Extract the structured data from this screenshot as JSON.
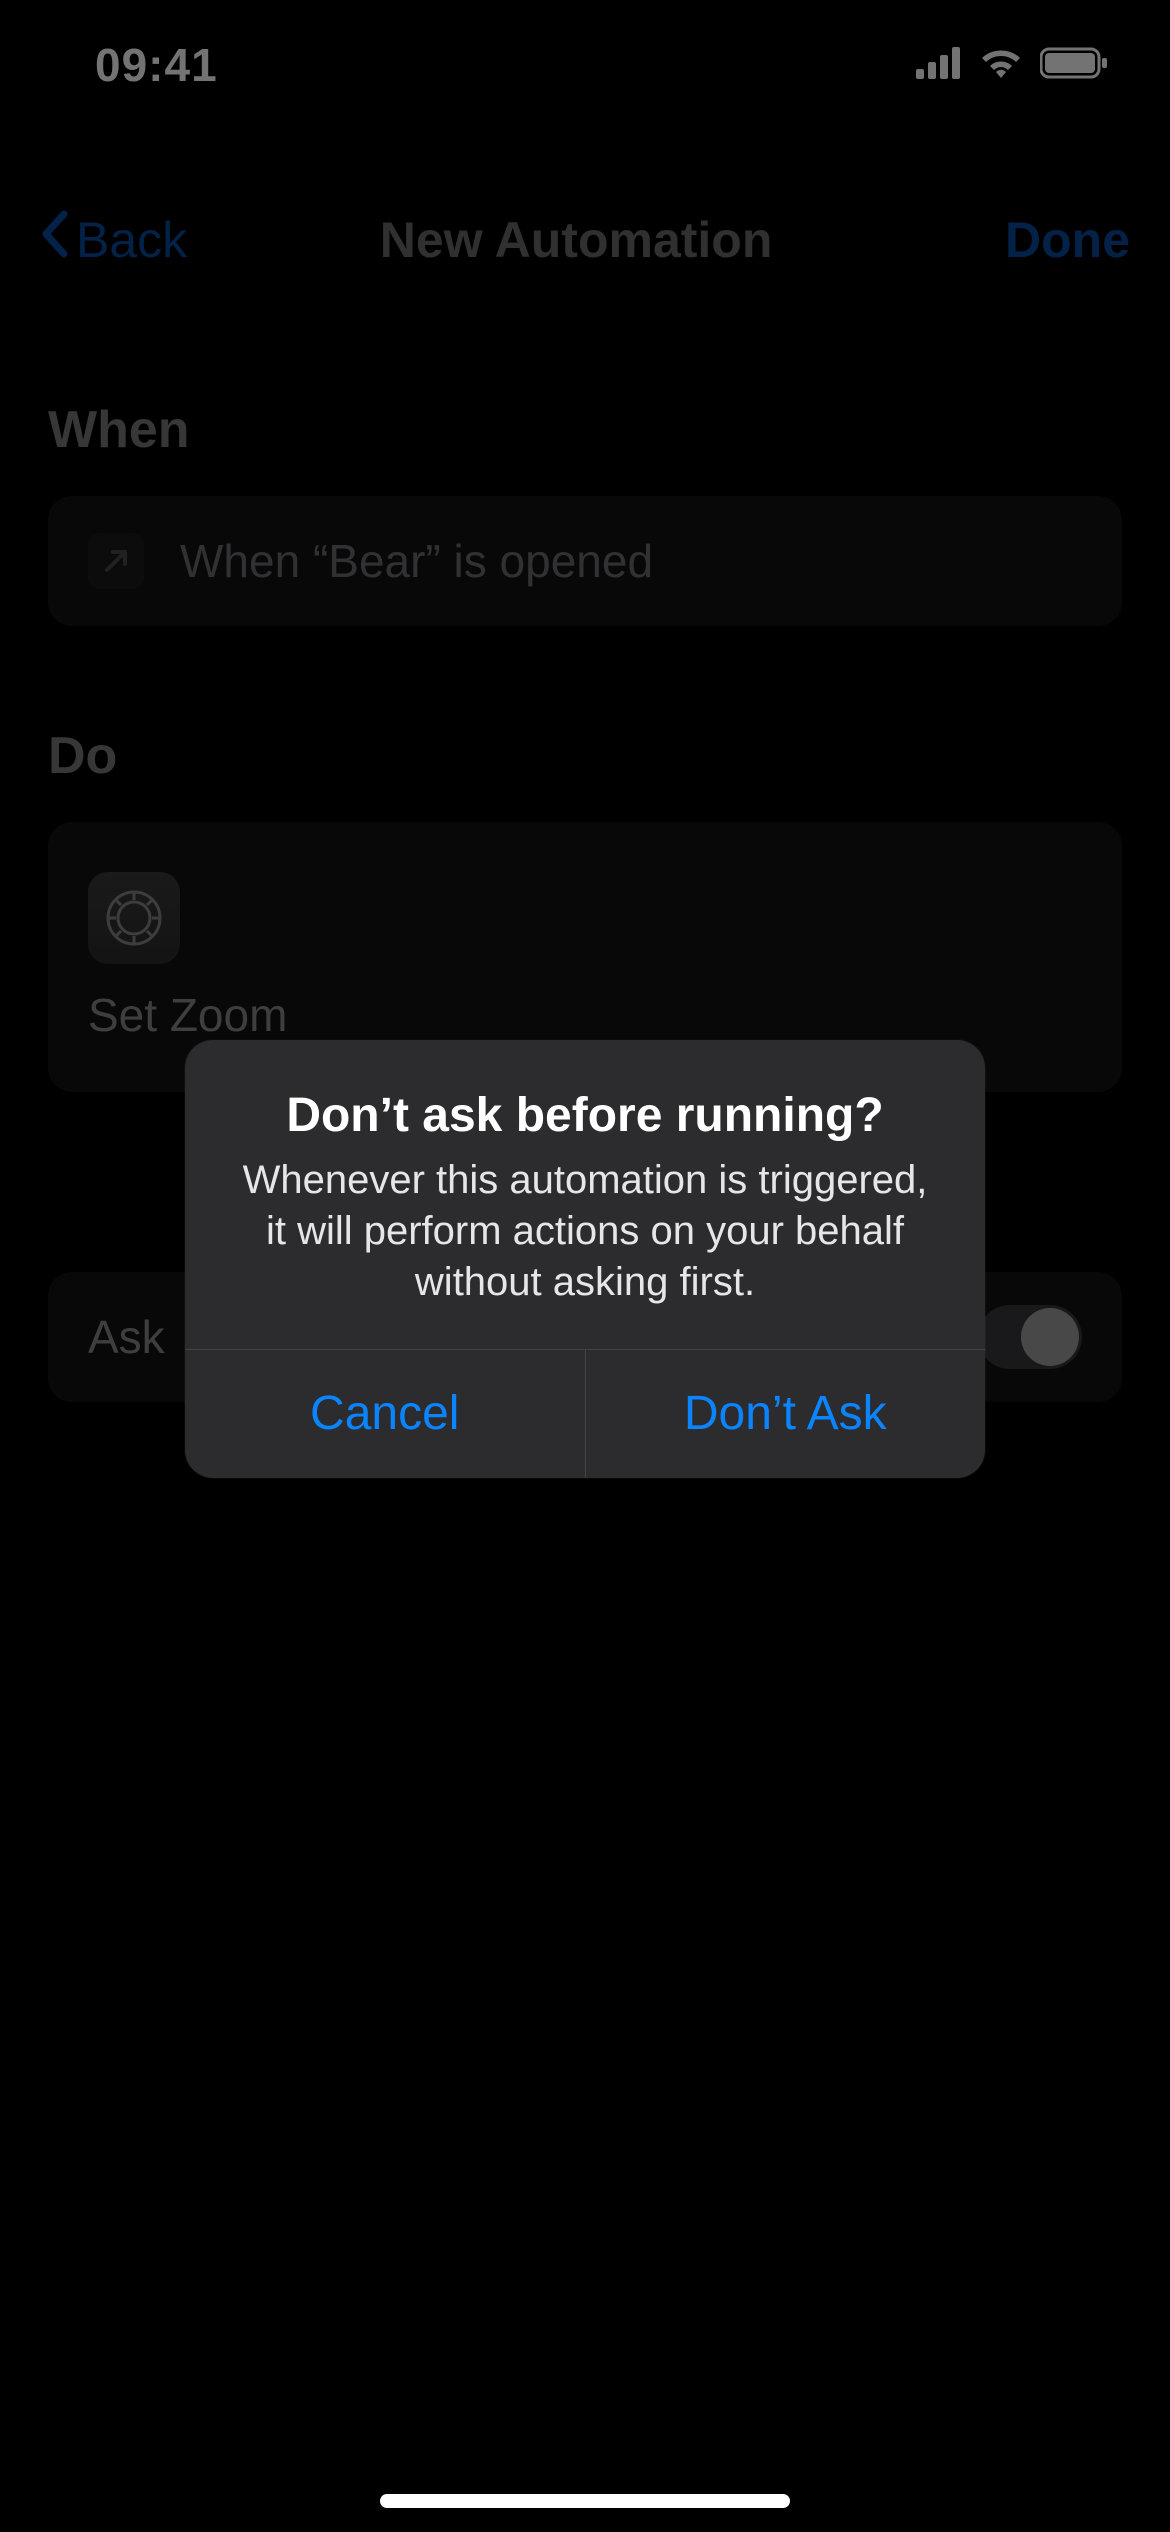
{
  "status_bar": {
    "time": "09:41"
  },
  "nav": {
    "back": "Back",
    "title": "New Automation",
    "done": "Done"
  },
  "sections": {
    "when_header": "When",
    "when_text": "When “Bear” is opened",
    "do_header": "Do",
    "do_action": "Set Zoom",
    "ask_label": "Ask"
  },
  "alert": {
    "title": "Don’t ask before running?",
    "message": "Whenever this automation is triggered, it will perform actions on your behalf without asking first.",
    "cancel": "Cancel",
    "confirm": "Don’t Ask"
  }
}
